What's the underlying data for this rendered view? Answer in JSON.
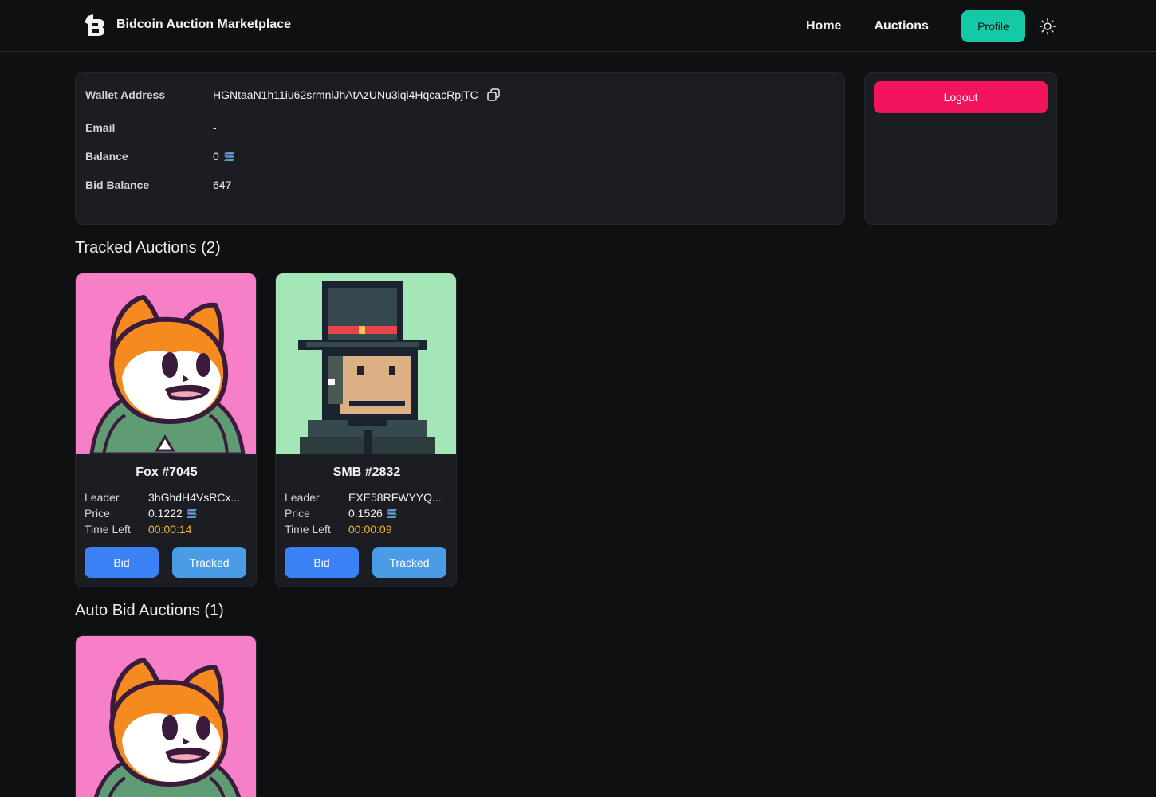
{
  "header": {
    "brand_name": "Bidcoin Auction Marketplace",
    "nav": {
      "home": "Home",
      "auctions": "Auctions",
      "profile": "Profile"
    },
    "accent": "#14c9a6"
  },
  "account": {
    "rows": [
      {
        "label": "Wallet Address",
        "value": "HGNtaaN1h11iu62srmniJhAtAzUNu3iqi4HqcacRpjTC"
      },
      {
        "label": "Email",
        "value": "-"
      },
      {
        "label": "Balance",
        "value": "0"
      },
      {
        "label": "Bid Balance",
        "value": "647"
      }
    ],
    "logout_label": "Logout",
    "logout_color": "#f2145c"
  },
  "tracked": {
    "title": "Tracked Auctions (2)",
    "cards": [
      {
        "name": "Fox #7045",
        "leader_label": "Leader",
        "leader": "3hGhdH4VsRCx...",
        "price_label": "Price",
        "price": "0.1222",
        "time_label": "Time Left",
        "time": "00:00:14",
        "bid_label": "Bid",
        "tracked_label": "Tracked",
        "image": "fox"
      },
      {
        "name": "SMB #2832",
        "leader_label": "Leader",
        "leader": "EXE58RFWYYQ...",
        "price_label": "Price",
        "price": "0.1526",
        "time_label": "Time Left",
        "time": "00:00:09",
        "bid_label": "Bid",
        "tracked_label": "Tracked",
        "image": "smb"
      }
    ]
  },
  "autobid": {
    "title": "Auto Bid Auctions (1)",
    "cards": [
      {
        "image": "fox"
      }
    ]
  }
}
